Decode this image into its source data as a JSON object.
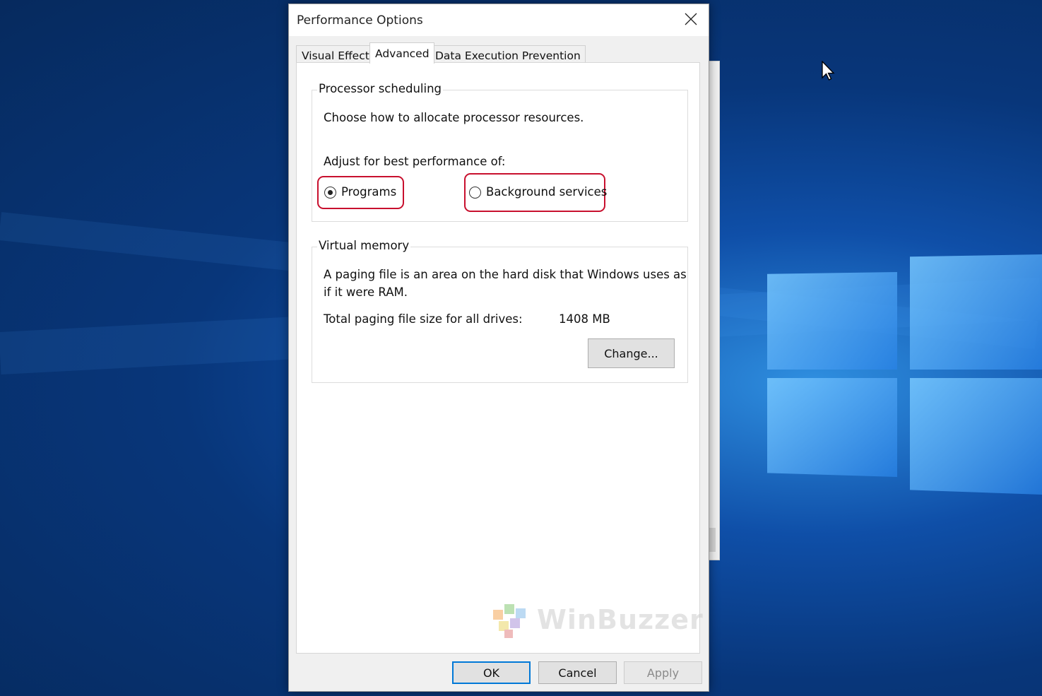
{
  "window": {
    "title": "Performance Options",
    "close_icon": "close-icon"
  },
  "tabs": [
    {
      "label": "Visual Effects",
      "active": false
    },
    {
      "label": "Advanced",
      "active": true
    },
    {
      "label": "Data Execution Prevention",
      "active": false
    }
  ],
  "processor_scheduling": {
    "group_label": "Processor scheduling",
    "description": "Choose how to allocate processor resources.",
    "adjust_label": "Adjust for best performance of:",
    "options": [
      {
        "label": "Programs",
        "checked": true
      },
      {
        "label": "Background services",
        "checked": false
      }
    ]
  },
  "virtual_memory": {
    "group_label": "Virtual memory",
    "description_line1": "A paging file is an area on the hard disk that Windows uses as",
    "description_line2": "if it were RAM.",
    "total_label": "Total paging file size for all drives:",
    "total_value": "1408 MB",
    "change_button": "Change..."
  },
  "footer": {
    "ok": "OK",
    "cancel": "Cancel",
    "apply": "Apply"
  },
  "watermark": {
    "brand": "WinBuzzer"
  },
  "colors": {
    "highlight": "#c8102e",
    "accent": "#0078d7"
  }
}
